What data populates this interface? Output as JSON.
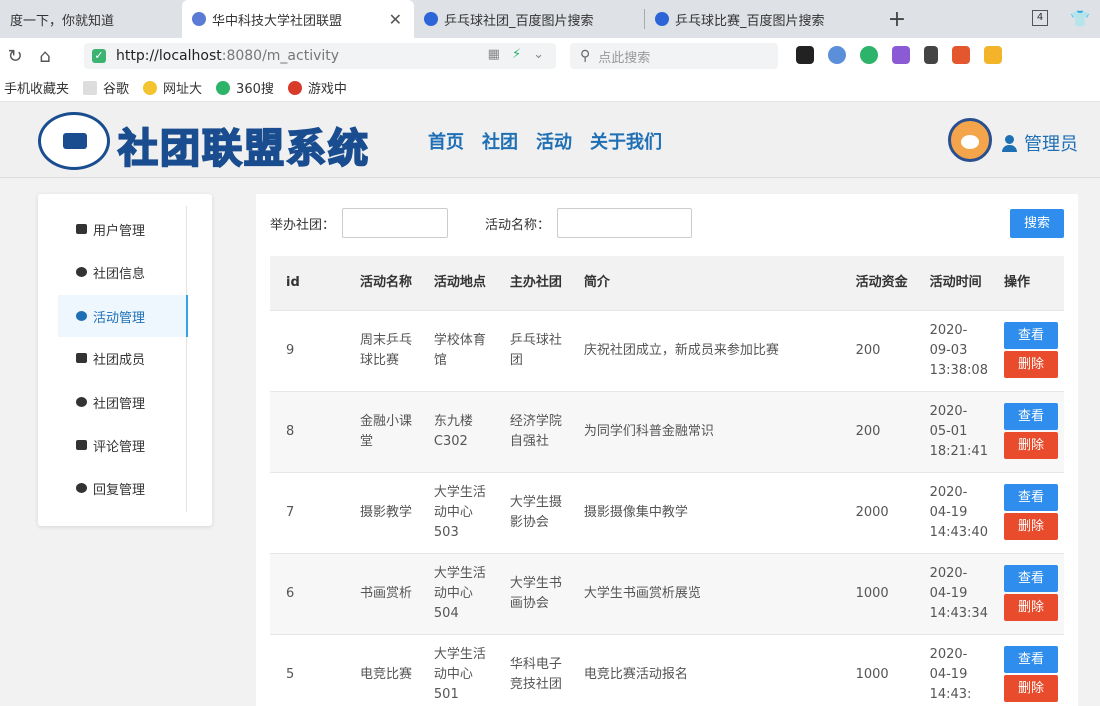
{
  "browser": {
    "tabs": [
      {
        "label": "度一下，你就知道"
      },
      {
        "label": "华中科技大学社团联盟",
        "close": "✕"
      },
      {
        "label": "乒乓球社团_百度图片搜索"
      },
      {
        "label": "乒乓球比赛_百度图片搜索"
      }
    ],
    "new_tab": "+",
    "tab_count": "4",
    "url_host": "http://localhost",
    "url_path": ":8080/m_activity",
    "search_placeholder": "点此搜索"
  },
  "bookmarks": [
    {
      "label": "手机收藏夹"
    },
    {
      "label": "谷歌"
    },
    {
      "label": "网址大"
    },
    {
      "label": "360搜"
    },
    {
      "label": "游戏中"
    }
  ],
  "header": {
    "logo_text": "社团联盟系统",
    "nav": [
      "首页",
      "社团",
      "活动",
      "关于我们"
    ],
    "user_label": "管理员"
  },
  "sidebar": {
    "items": [
      {
        "label": "用户管理"
      },
      {
        "label": "社团信息"
      },
      {
        "label": "活动管理",
        "active": true
      },
      {
        "label": "社团成员"
      },
      {
        "label": "社团管理"
      },
      {
        "label": "评论管理"
      },
      {
        "label": "回复管理"
      }
    ]
  },
  "filters": {
    "club_label": "举办社团：",
    "club_value": "",
    "name_label": "活动名称：",
    "name_value": "",
    "search_label": "搜索"
  },
  "table": {
    "headers": [
      "id",
      "活动名称",
      "活动地点",
      "主办社团",
      "简介",
      "活动资金",
      "活动时间",
      "操作"
    ],
    "view_label": "查看",
    "delete_label": "删除",
    "rows": [
      {
        "id": "9",
        "name": "周末乒乓球比赛",
        "place": "学校体育馆",
        "club": "乒乓球社团",
        "intro": "庆祝社团成立，新成员来参加比赛",
        "fund": "200",
        "time": "2020-09-03 13:38:08"
      },
      {
        "id": "8",
        "name": "金融小课堂",
        "place": "东九楼C302",
        "club": "经济学院自强社",
        "intro": "为同学们科普金融常识",
        "fund": "200",
        "time": "2020-05-01 18:21:41"
      },
      {
        "id": "7",
        "name": "摄影教学",
        "place": "大学生活动中心503",
        "club": "大学生摄影协会",
        "intro": "摄影摄像集中教学",
        "fund": "2000",
        "time": "2020-04-19 14:43:40"
      },
      {
        "id": "6",
        "name": "书画赏析",
        "place": "大学生活动中心504",
        "club": "大学生书画协会",
        "intro": "大学生书画赏析展览",
        "fund": "1000",
        "time": "2020-04-19 14:43:34"
      },
      {
        "id": "5",
        "name": "电竞比赛",
        "place": "大学生活动中心501",
        "club": "华科电子竞技社团",
        "intro": "电竞比赛活动报名",
        "fund": "1000",
        "time": "2020-04-19 14:43:"
      }
    ]
  }
}
